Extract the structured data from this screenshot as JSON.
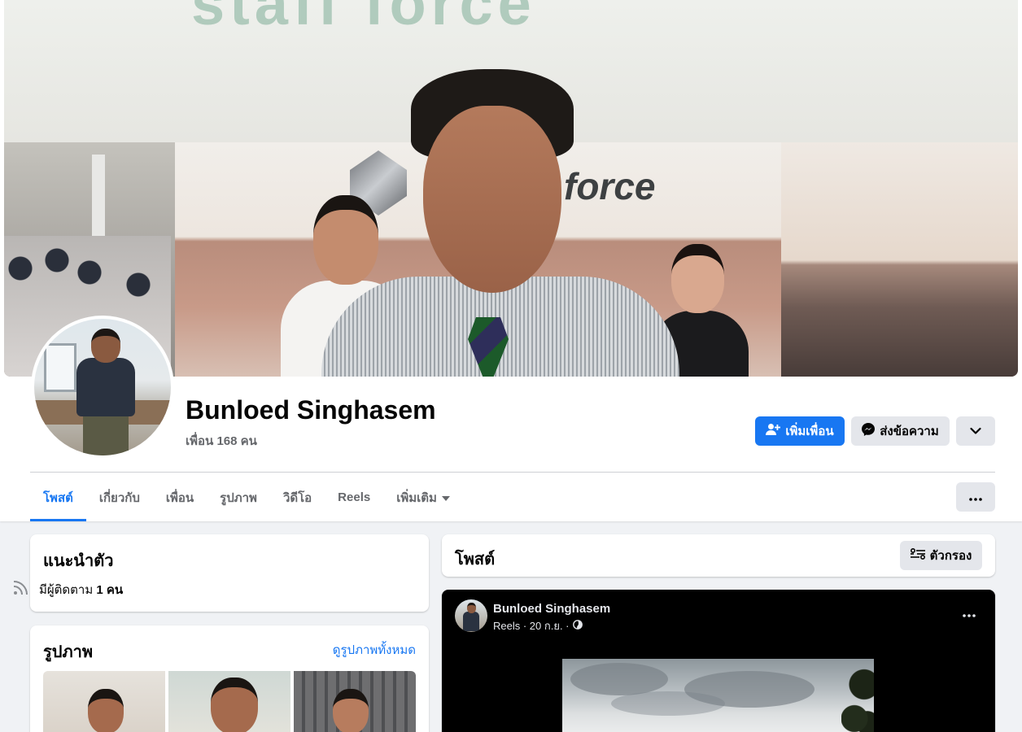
{
  "profile": {
    "name": "Bunloed Singhasem",
    "friends_count": "เพื่อน 168 คน"
  },
  "cover": {
    "banner_text": "staff force",
    "booth_text": "force"
  },
  "actions": {
    "add_friend_label": "เพิ่มเพื่อน",
    "message_label": "ส่งข้อความ",
    "dropdown_icon": "chevron-down-icon",
    "more_icon": "ellipsis-icon"
  },
  "tabs": [
    {
      "label": "โพสต์",
      "active": true
    },
    {
      "label": "เกี่ยวกับ",
      "active": false
    },
    {
      "label": "เพื่อน",
      "active": false
    },
    {
      "label": "รูปภาพ",
      "active": false
    },
    {
      "label": "วิดีโอ",
      "active": false
    },
    {
      "label": "Reels",
      "active": false
    },
    {
      "label": "เพิ่มเติม",
      "active": false
    }
  ],
  "intro": {
    "title": "แนะนำตัว",
    "followers_text": "มีผู้ติดตาม",
    "followers_count": "1 คน"
  },
  "photos": {
    "title": "รูปภาพ",
    "see_all_label": "ดูรูปภาพทั้งหมด"
  },
  "posts": {
    "title": "โพสต์",
    "filter_label": "ตัวกรอง"
  },
  "reel_post": {
    "author": "Bunloed Singhasem",
    "meta": "Reels · 20 ก.ย. ·"
  },
  "colors": {
    "primary": "#1877f2",
    "secondary_button": "#e4e6eb",
    "page_background": "#f0f2f5",
    "text_secondary": "#65676b"
  }
}
